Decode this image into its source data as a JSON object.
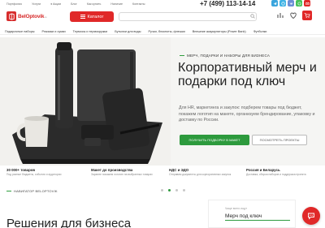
{
  "topbar": {
    "links": [
      "Портфолио",
      "Услуги",
      "Акции",
      "Блог",
      "Как купить",
      "Наличие",
      "Контакты"
    ],
    "phone": "+7 (499) 113-14-14",
    "callback": "Заказать звонок"
  },
  "logo": {
    "name": "BelOptovik",
    "sub": ".ru"
  },
  "header": {
    "catalog_label": "Каталог",
    "search_placeholder": ""
  },
  "nav": {
    "categories": [
      "Подарочные наборы",
      "Рюкзаки и сумки",
      "Термосы и термокружки",
      "Бутылки для воды",
      "Ручки, блокноты, флешки",
      "Внешние аккумуляторы (Power Bank)",
      "Футболки"
    ]
  },
  "hero": {
    "eyebrow": "МЕРЧ, ПОДАРКИ И НАБОРЫ ДЛЯ БИЗНЕСА",
    "title": "Корпоративный мерч и подарки под ключ",
    "description": "Для HR, маркетинга и закупок: подберем товары под бюджет, покажем логотип на макете, организуем брендирование, упаковку и доставку по России.",
    "primary_cta": "ПОЛУЧИТЬ ПОДБОРКУ В МАКЕТ",
    "secondary_cta": "ПОСМОТРЕТЬ ПРОЕКТЫ",
    "slides": 4,
    "active_slide": 2
  },
  "features": [
    {
      "title": "30 000+ товаров",
      "desc": "Под разные бюджеты, события и аудитории"
    },
    {
      "title": "Макет до производства",
      "desc": "Заранее покажем логотип на выбранных товарах"
    },
    {
      "title": "НДС и ЭДО",
      "desc": "Отправим документы для корпоративных закупок"
    },
    {
      "title": "Россия и Беларусь",
      "desc": "Доставка, сборка наборов и поддержка проекта"
    }
  ],
  "bottom": {
    "kicker": "НАВИГАТОР BELOPTOVIK",
    "section_title": "Решения для бизнеса",
    "popular_label": "Чаще всего ищут",
    "popular_value": "Мерч под ключ"
  },
  "colors": {
    "brand_red": "#e02828",
    "accent_green": "#2d9a3d",
    "social": [
      "#3aa5dd",
      "#3fb3e5",
      "#6b8fd6",
      "#47c35a",
      "#e02828"
    ]
  }
}
